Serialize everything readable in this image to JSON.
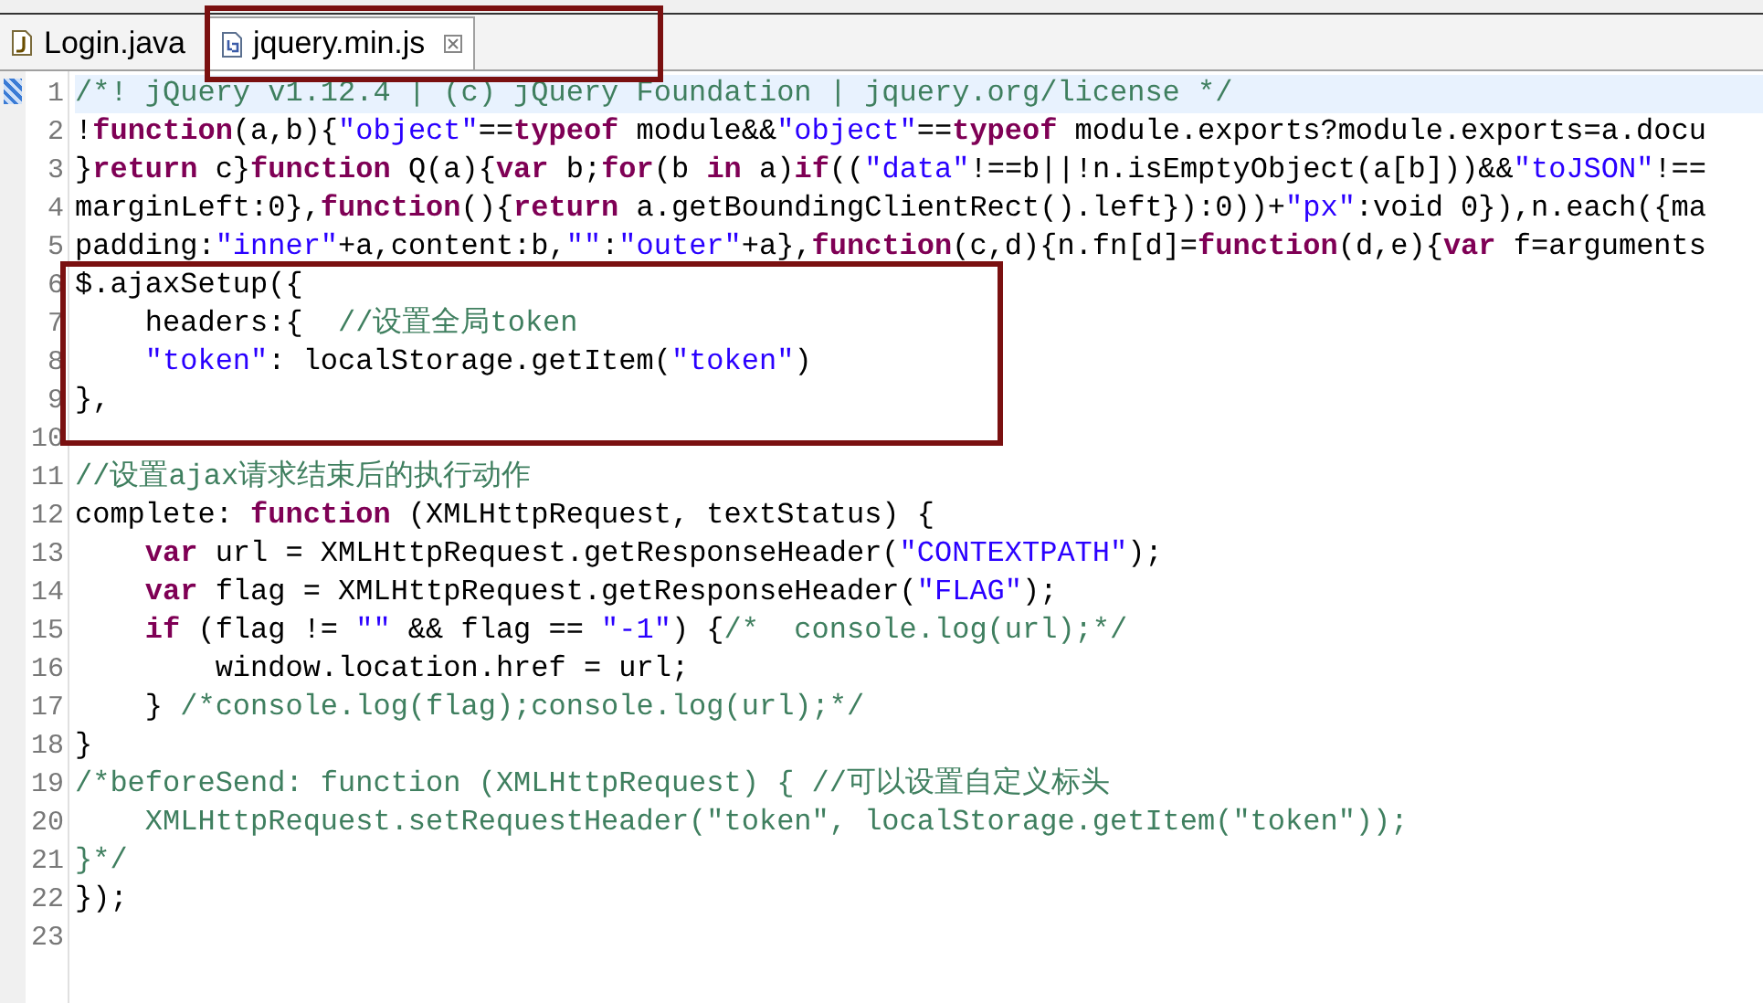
{
  "tabs": [
    {
      "label": "Login.java",
      "kind": "java",
      "selected": false
    },
    {
      "label": "jquery.min.js",
      "kind": "js",
      "selected": true
    }
  ],
  "editor": {
    "lines": [
      {
        "number": "1",
        "current": true,
        "tokens": [
          {
            "kind": "comment",
            "text": "/*! jQuery v1.12.4 | (c) jQuery Foundation | jquery.org/license */"
          }
        ]
      },
      {
        "number": "2",
        "current": false,
        "tokens": [
          {
            "kind": "plain",
            "text": "!"
          },
          {
            "kind": "keyword",
            "text": "function"
          },
          {
            "kind": "plain",
            "text": "(a,b){"
          },
          {
            "kind": "string",
            "text": "\"object\""
          },
          {
            "kind": "plain",
            "text": "=="
          },
          {
            "kind": "keyword",
            "text": "typeof"
          },
          {
            "kind": "plain",
            "text": " module&&"
          },
          {
            "kind": "string",
            "text": "\"object\""
          },
          {
            "kind": "plain",
            "text": "=="
          },
          {
            "kind": "keyword",
            "text": "typeof"
          },
          {
            "kind": "plain",
            "text": " module.exports?module.exports=a.docu"
          }
        ]
      },
      {
        "number": "3",
        "current": false,
        "tokens": [
          {
            "kind": "plain",
            "text": "}"
          },
          {
            "kind": "keyword",
            "text": "return"
          },
          {
            "kind": "plain",
            "text": " c}"
          },
          {
            "kind": "keyword",
            "text": "function"
          },
          {
            "kind": "plain",
            "text": " Q(a){"
          },
          {
            "kind": "keyword",
            "text": "var"
          },
          {
            "kind": "plain",
            "text": " b;"
          },
          {
            "kind": "keyword",
            "text": "for"
          },
          {
            "kind": "plain",
            "text": "(b "
          },
          {
            "kind": "keyword",
            "text": "in"
          },
          {
            "kind": "plain",
            "text": " a)"
          },
          {
            "kind": "keyword",
            "text": "if"
          },
          {
            "kind": "plain",
            "text": "(("
          },
          {
            "kind": "string",
            "text": "\"data\""
          },
          {
            "kind": "plain",
            "text": "!==b||!n.isEmptyObject(a[b]))&&"
          },
          {
            "kind": "string",
            "text": "\"toJSON\""
          },
          {
            "kind": "plain",
            "text": "!=="
          }
        ]
      },
      {
        "number": "4",
        "current": false,
        "tokens": [
          {
            "kind": "plain",
            "text": "marginLeft:0},"
          },
          {
            "kind": "keyword",
            "text": "function"
          },
          {
            "kind": "plain",
            "text": "(){"
          },
          {
            "kind": "keyword",
            "text": "return"
          },
          {
            "kind": "plain",
            "text": " a.getBoundingClientRect().left}):0))+"
          },
          {
            "kind": "string",
            "text": "\"px\""
          },
          {
            "kind": "plain",
            "text": ":void 0}),n.each({ma"
          }
        ]
      },
      {
        "number": "5",
        "current": false,
        "tokens": [
          {
            "kind": "plain",
            "text": "padding:"
          },
          {
            "kind": "string",
            "text": "\"inner\""
          },
          {
            "kind": "plain",
            "text": "+a,content:b,"
          },
          {
            "kind": "string",
            "text": "\"\""
          },
          {
            "kind": "plain",
            "text": ":"
          },
          {
            "kind": "string",
            "text": "\"outer\""
          },
          {
            "kind": "plain",
            "text": "+a},"
          },
          {
            "kind": "keyword",
            "text": "function"
          },
          {
            "kind": "plain",
            "text": "(c,d){n.fn[d]="
          },
          {
            "kind": "keyword",
            "text": "function"
          },
          {
            "kind": "plain",
            "text": "(d,e){"
          },
          {
            "kind": "keyword",
            "text": "var"
          },
          {
            "kind": "plain",
            "text": " f=arguments"
          }
        ]
      },
      {
        "number": "6",
        "current": false,
        "tokens": [
          {
            "kind": "plain",
            "text": "$.ajaxSetup({"
          }
        ]
      },
      {
        "number": "7",
        "current": false,
        "tokens": [
          {
            "kind": "plain",
            "text": "    headers:{  "
          },
          {
            "kind": "comment",
            "text": "//设置全局token"
          }
        ]
      },
      {
        "number": "8",
        "current": false,
        "tokens": [
          {
            "kind": "string",
            "text": "    \"token\""
          },
          {
            "kind": "plain",
            "text": ": localStorage.getItem("
          },
          {
            "kind": "string",
            "text": "\"token\""
          },
          {
            "kind": "plain",
            "text": ")"
          }
        ]
      },
      {
        "number": "9",
        "current": false,
        "tokens": [
          {
            "kind": "plain",
            "text": "},"
          }
        ]
      },
      {
        "number": "10",
        "current": false
      },
      {
        "number": "11",
        "current": false,
        "tokens": [
          {
            "kind": "comment",
            "text": "//设置ajax请求结束后的执行动作"
          }
        ]
      },
      {
        "number": "12",
        "current": false,
        "tokens": [
          {
            "kind": "plain",
            "text": "complete: "
          },
          {
            "kind": "keyword",
            "text": "function"
          },
          {
            "kind": "plain",
            "text": " (XMLHttpRequest, textStatus) {"
          }
        ]
      },
      {
        "number": "13",
        "current": false,
        "tokens": [
          {
            "kind": "keyword",
            "text": "    var"
          },
          {
            "kind": "plain",
            "text": " url = XMLHttpRequest.getResponseHeader("
          },
          {
            "kind": "string",
            "text": "\"CONTEXTPATH\""
          },
          {
            "kind": "plain",
            "text": ");"
          }
        ]
      },
      {
        "number": "14",
        "current": false,
        "tokens": [
          {
            "kind": "keyword",
            "text": "    var"
          },
          {
            "kind": "plain",
            "text": " flag = XMLHttpRequest.getResponseHeader("
          },
          {
            "kind": "string",
            "text": "\"FLAG\""
          },
          {
            "kind": "plain",
            "text": ");"
          }
        ]
      },
      {
        "number": "15",
        "current": false,
        "tokens": [
          {
            "kind": "keyword",
            "text": "    if"
          },
          {
            "kind": "plain",
            "text": " (flag != "
          },
          {
            "kind": "string",
            "text": "\"\""
          },
          {
            "kind": "plain",
            "text": " && flag == "
          },
          {
            "kind": "string",
            "text": "\"-1\""
          },
          {
            "kind": "plain",
            "text": ") {"
          },
          {
            "kind": "comment",
            "text": "/*  console.log(url);*/"
          }
        ]
      },
      {
        "number": "16",
        "current": false,
        "tokens": [
          {
            "kind": "plain",
            "text": "        window.location.href = url;"
          }
        ]
      },
      {
        "number": "17",
        "current": false,
        "tokens": [
          {
            "kind": "plain",
            "text": "    } "
          },
          {
            "kind": "comment",
            "text": "/*console.log(flag);console.log(url);*/"
          }
        ]
      },
      {
        "number": "18",
        "current": false,
        "tokens": [
          {
            "kind": "plain",
            "text": "}"
          }
        ]
      },
      {
        "number": "19",
        "current": false,
        "tokens": [
          {
            "kind": "comment",
            "text": "/*beforeSend: function (XMLHttpRequest) { //可以设置自定义标头"
          }
        ]
      },
      {
        "number": "20",
        "current": false,
        "tokens": [
          {
            "kind": "comment",
            "text": "    XMLHttpRequest.setRequestHeader(\"token\", localStorage.getItem(\"token\"));"
          }
        ]
      },
      {
        "number": "21",
        "current": false,
        "tokens": [
          {
            "kind": "comment",
            "text": "}*/"
          }
        ]
      },
      {
        "number": "22",
        "current": false,
        "tokens": [
          {
            "kind": "plain",
            "text": "});"
          }
        ]
      },
      {
        "number": "23",
        "current": false
      }
    ]
  }
}
